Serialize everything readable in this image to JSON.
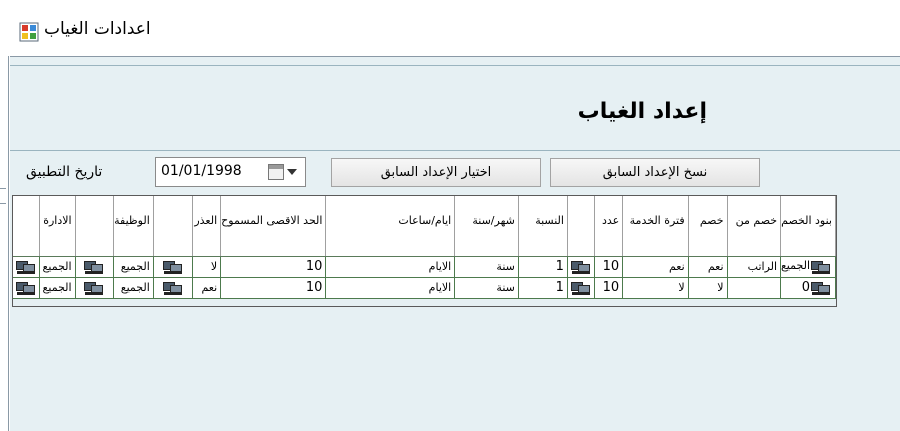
{
  "window": {
    "title": "اعدادات الغياب"
  },
  "header": {
    "heading": "إعداد الغياب"
  },
  "toolbar": {
    "date_label": "تاريخ التطبيق",
    "date_value": "01/01/1998",
    "select_previous_label": "اختيار الإعداد السابق",
    "copy_previous_label": "نسخ الإعداد السابق"
  },
  "grid": {
    "columns": [
      "بنود الخصم",
      "خصم من",
      "خصم",
      "فترة الخدمة",
      "عدد",
      "",
      "النسبة",
      "شهر/سنة",
      "ايام/ساعات",
      "الحد الاقصى المسموح",
      "العذر",
      "",
      "الوظيفة",
      "",
      "الادارة",
      ""
    ],
    "rows": [
      [
        "",
        "الراتب",
        "نعم",
        "نعم",
        "10",
        "",
        "1",
        "سنة",
        "الايام",
        "10",
        "لا",
        "",
        "الجميع",
        "",
        "الجميع",
        ""
      ],
      [
        "0",
        "",
        "لا",
        "لا",
        "10",
        "",
        "1",
        "سنة",
        "الايام",
        "10",
        "نعم",
        "",
        "الجميع",
        "",
        "الجميع",
        ""
      ]
    ],
    "row1_first_cell_text": "الجميع"
  },
  "icons": {
    "app": "app-window-icon",
    "row_button": "computers-icon",
    "calendar": "calendar-icon",
    "dropdown": "chevron-down-icon"
  },
  "colors": {
    "client_bg": "#e6f0f3",
    "grid_line": "#4d7a4d"
  }
}
